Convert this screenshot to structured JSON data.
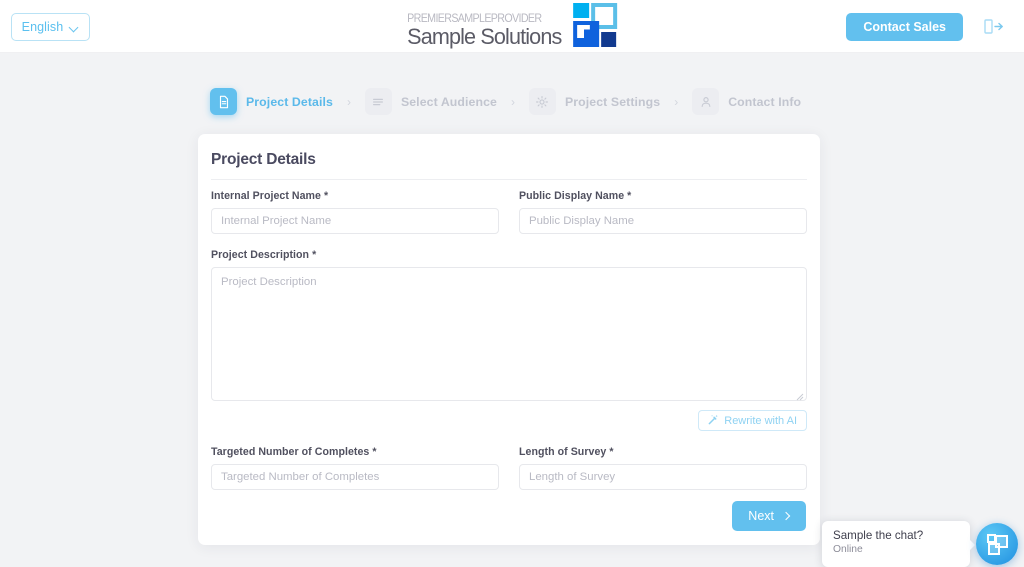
{
  "header": {
    "language_selector": {
      "label": "English",
      "chevron_icon": "chevron-down-icon"
    },
    "logo": {
      "tagline": "PREMIERSAMPLEPROVIDER",
      "name": "Sample Solutions",
      "mark_icon": "squares-logo-mark"
    },
    "contact_sales_label": "Contact Sales",
    "login_icon": "login-arrow-icon"
  },
  "stepper": {
    "separator": "›",
    "steps": [
      {
        "label": "Project Details",
        "icon": "document-icon",
        "active": true
      },
      {
        "label": "Select Audience",
        "icon": "list-lines-icon",
        "active": false
      },
      {
        "label": "Project Settings",
        "icon": "gear-icon",
        "active": false
      },
      {
        "label": "Contact Info",
        "icon": "person-icon",
        "active": false
      }
    ]
  },
  "form": {
    "title": "Project Details",
    "internal_project_name": {
      "label": "Internal Project Name *",
      "value": "",
      "placeholder": "Internal Project Name"
    },
    "public_display_name": {
      "label": "Public Display Name *",
      "value": "",
      "placeholder": "Public Display Name"
    },
    "project_description": {
      "label": "Project Description *",
      "value": "",
      "placeholder": "Project Description"
    },
    "rewrite_button": {
      "label": "Rewrite with AI",
      "icon": "magic-wand-icon"
    },
    "targeted_number_of_completes": {
      "label": "Targeted Number of Completes *",
      "value": "",
      "placeholder": "Targeted Number of Completes"
    },
    "length_of_survey": {
      "label": "Length of Survey *",
      "value": "",
      "placeholder": "Length of Survey"
    },
    "next_button": {
      "label": "Next",
      "icon": "chevron-right-icon"
    }
  },
  "chat_widget": {
    "title": "Sample the chat?",
    "status": "Online",
    "fab_icon": "chat-logo-icon"
  },
  "colors": {
    "accent": "#62c0ee",
    "accent_light": "#8fd2f2",
    "page_bg": "#f2f3f5",
    "text_dark": "#4a4a60",
    "muted": "#c2c5cf"
  }
}
